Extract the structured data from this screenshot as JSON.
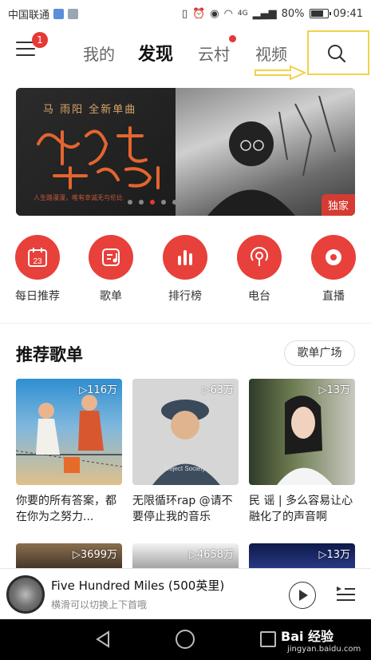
{
  "status_bar": {
    "carrier": "中国联通",
    "network": "4G",
    "battery": "80%",
    "battery_level": 0.8,
    "time": "09:41"
  },
  "header": {
    "menu_badge": "1",
    "tabs": [
      {
        "label": "我的",
        "active": false
      },
      {
        "label": "发现",
        "active": true
      },
      {
        "label": "云村",
        "active": false,
        "dot": true
      },
      {
        "label": "视频",
        "active": false
      }
    ],
    "search_icon": "search-icon",
    "highlight_color": "#f2d14a"
  },
  "banner": {
    "subtitle": "马 雨阳 全新单曲",
    "calligraphy": "用孤独开启谷欠",
    "tagline": "人生路漫漫，唯有幸诚无与伦比",
    "tag": "独家",
    "active_dot": 2
  },
  "shortcuts": [
    {
      "label": "每日推荐",
      "icon": "calendar-icon",
      "day": "23"
    },
    {
      "label": "歌单",
      "icon": "playlist-icon"
    },
    {
      "label": "排行榜",
      "icon": "chart-icon"
    },
    {
      "label": "电台",
      "icon": "radio-icon"
    },
    {
      "label": "直播",
      "icon": "live-icon"
    }
  ],
  "section": {
    "title": "推荐歌单",
    "more": "歌单广场"
  },
  "playlists": [
    {
      "count": "▷116万",
      "title": "你要的所有答案，都在你为之努力..."
    },
    {
      "count": "▷63万",
      "title": "无限循环rap @请不要停止我的音乐"
    },
    {
      "count": "▷13万",
      "title": "民 谣 | 多么容易让心融化了的声音啊"
    }
  ],
  "playlists_row2": [
    {
      "count": "▷3699万"
    },
    {
      "count": "▷4658万"
    },
    {
      "count": "▷13万"
    }
  ],
  "player": {
    "title": "Five Hundred Miles (500英里)",
    "subtitle": "横滑可以切换上下首哦"
  },
  "watermark": {
    "brand": "Bai 经验",
    "url": "jingyan.baidu.com"
  },
  "colors": {
    "accent": "#e8403a",
    "tag": "#d43c33"
  }
}
